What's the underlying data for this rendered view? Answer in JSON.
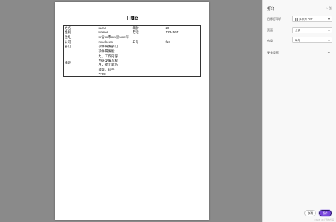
{
  "document": {
    "title": "Title",
    "rows": [
      {
        "l1": "姓名",
        "v1": "name",
        "l2": "年龄",
        "v2": "20"
      },
      {
        "l1": "性别",
        "v1": "women",
        "l2": "电话",
        "v2": "1234567"
      },
      {
        "l1": "住址",
        "v1": "xx省xx市xxx县xxxx号"
      },
      {
        "l1": "公司",
        "v1": "zxxxlneeol",
        "l2": "工号",
        "v2": "f10"
      },
      {
        "l1": "部门",
        "v1": "软件研发部门"
      },
      {
        "l1": "描述",
        "v1": "软件研发能力，工作内容为研发编写程序，提出新功能等，对于7799"
      }
    ]
  },
  "print_panel": {
    "title": "打印",
    "sheet_count": "1 张",
    "destination_label": "目标打印机",
    "destination_value": "另存为 PDF",
    "pages_label": "页面",
    "pages_value": "全部",
    "layout_label": "布局",
    "layout_value": "纵向",
    "more_settings": "更多设置",
    "cancel_label": "取消",
    "save_label": "保存"
  },
  "icons": {
    "select_chevron": "chevron-down-icon",
    "more_chevron": "chevron-down-icon",
    "destination_icon": "pdf-file-icon"
  },
  "colors": {
    "preview_background": "#8a8a8a",
    "save_button": "#7744dd"
  },
  "watermark": "CSDN @小王的代码"
}
